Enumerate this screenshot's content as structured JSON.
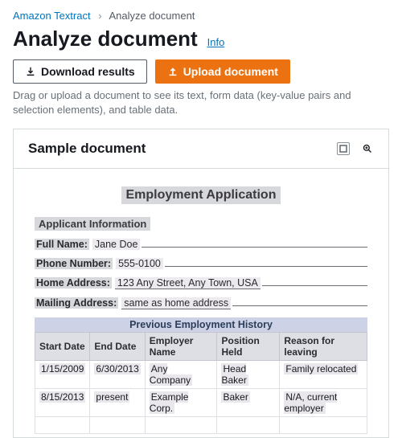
{
  "breadcrumb": {
    "root": "Amazon Textract",
    "current": "Analyze document"
  },
  "header": {
    "title": "Analyze document",
    "info": "Info"
  },
  "buttons": {
    "download": "Download results",
    "upload": "Upload document"
  },
  "help": "Drag or upload a document to see its text, form data (key-value pairs and selection elements), and table data.",
  "panel": {
    "title": "Sample document"
  },
  "doc": {
    "title": "Employment Application",
    "section1": "Applicant Information",
    "fields": {
      "fullname_label": "Full Name:",
      "fullname_value": "Jane Doe",
      "phone_label": "Phone Number:",
      "phone_value": "555-0100",
      "home_label": "Home Address:",
      "home_value": "123 Any Street, Any Town, USA",
      "mail_label": "Mailing Address:",
      "mail_value": "same as home address"
    },
    "table": {
      "title": "Previous Employment History",
      "headers": [
        "Start Date",
        "End Date",
        "Employer Name",
        "Position Held",
        "Reason for leaving"
      ],
      "rows": [
        [
          "1/15/2009",
          "6/30/2013",
          "Any Company",
          "Head Baker",
          "Family relocated"
        ],
        [
          "8/15/2013",
          "present",
          "Example Corp.",
          "Baker",
          "N/A, current employer"
        ],
        [
          "",
          "",
          "",
          "",
          ""
        ]
      ]
    }
  }
}
